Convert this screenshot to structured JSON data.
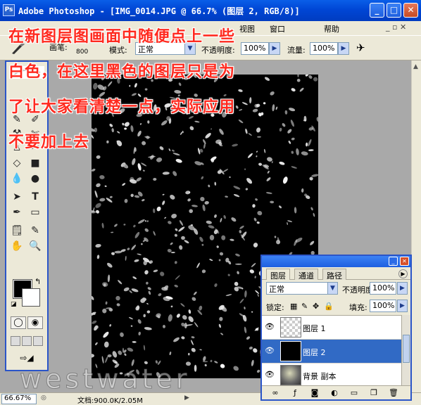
{
  "window": {
    "app_icon": "Ps",
    "title": "Adobe Photoshop - [IMG_0014.JPG @ 66.7% (图层 2, RGB/8)]",
    "minimize": "_",
    "maximize": "□",
    "close": "✕"
  },
  "menubar": {
    "items": [
      "视图",
      "窗口",
      "帮助"
    ],
    "doc_restore": "_ ▫ ✕"
  },
  "options_bar": {
    "brush_label": "画笔:",
    "brush_size": "800",
    "mode_label": "模式:",
    "mode_value": "正常",
    "opacity_label": "不透明度:",
    "opacity_value": "100%",
    "flow_label": "流量:",
    "flow_value": "100%"
  },
  "annotation": {
    "lines": [
      "在新图层图画面中随便点上一些",
      "白色，在这里黑色的图层只是为",
      "了让大家看清楚一点，实际应用",
      "不要加上去"
    ],
    "color": "#ff2a1f"
  },
  "watermark": "westwater",
  "toolbox": {
    "tools": [
      "move",
      "lasso",
      "crop",
      "heal",
      "stamp",
      "eraser",
      "gradient",
      "blur",
      "dodge",
      "path-select",
      "type",
      "pen",
      "shape",
      "notes",
      "eyedropper",
      "hand",
      "zoom"
    ],
    "tool_glyphs": {
      "type": "T",
      "hand": "✋",
      "zoom": "🔍"
    },
    "swap_glyph": "↰",
    "default_glyph": "◪",
    "foreground_color": "#000000",
    "background_color": "#ffffff"
  },
  "statusbar": {
    "zoom": "66.67%",
    "doc_info": "文档:900.0K/2.05M"
  },
  "layers_panel": {
    "tabs": [
      "图层",
      "通道",
      "路径"
    ],
    "blend_mode": "正常",
    "opacity_label": "不透明度:",
    "opacity_value": "100%",
    "lock_label": "锁定:",
    "fill_label": "填充:",
    "fill_value": "100%",
    "layers": [
      {
        "name": "图层 1",
        "selected": false
      },
      {
        "name": "图层 2",
        "selected": true
      },
      {
        "name": "背景 副本",
        "selected": false
      }
    ]
  },
  "colors": {
    "xp_blue": "#0046d5",
    "selection": "#316ac5",
    "workspace": "#a9a9a9",
    "annotation": "#ff2a1f"
  }
}
